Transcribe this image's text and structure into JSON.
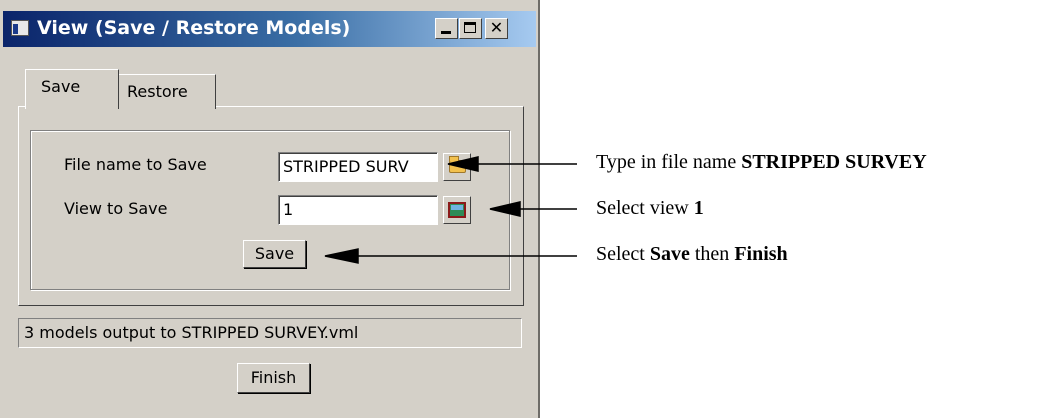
{
  "window": {
    "title": "View (Save / Restore Models)",
    "close_glyph": "✕"
  },
  "tabs": [
    {
      "label": "Save",
      "active": true
    },
    {
      "label": "Restore",
      "active": false
    }
  ],
  "form": {
    "file_name_label": "File name to Save",
    "file_name_value": "STRIPPED SURV",
    "view_label": "View to Save",
    "view_value": "1",
    "save_button": "Save"
  },
  "status_text": "3 models output to STRIPPED SURVEY.vml",
  "finish_button": "Finish",
  "annotations": [
    {
      "prefix": "Type in file name ",
      "bold": "STRIPPED SURVEY",
      "mid": "",
      "bold2": ""
    },
    {
      "prefix": "Select view ",
      "bold": "1",
      "mid": "",
      "bold2": ""
    },
    {
      "prefix": "Select ",
      "bold": "Save",
      "mid": " then ",
      "bold2": "Finish"
    }
  ],
  "icons": {
    "app": "app-window-icon",
    "file_browse": "folder-icon",
    "view_pick": "view-select-icon"
  }
}
